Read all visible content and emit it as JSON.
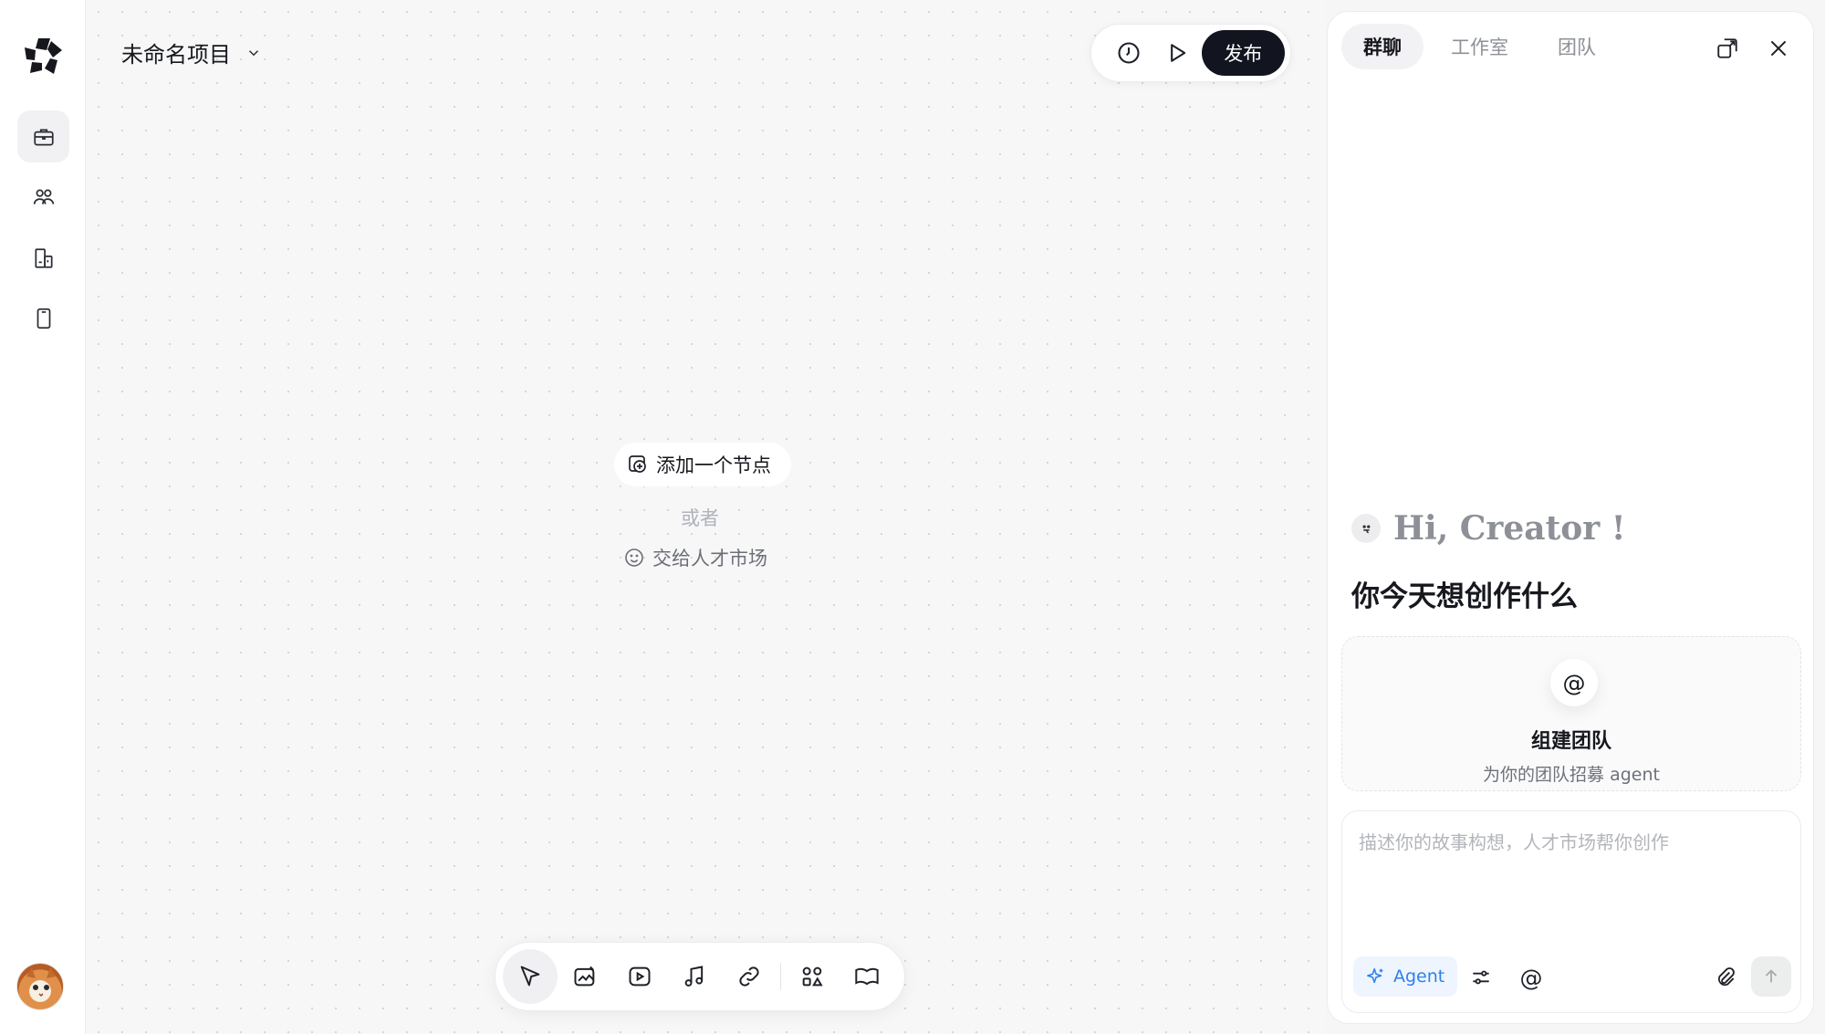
{
  "project": {
    "title": "未命名项目"
  },
  "topbar": {
    "publish_label": "发布"
  },
  "canvas": {
    "add_node_label": "添加一个节点",
    "or_label": "或者",
    "talent_label": "交给人才市场"
  },
  "panel": {
    "tabs": [
      {
        "label": "群聊"
      },
      {
        "label": "工作室"
      },
      {
        "label": "团队"
      }
    ],
    "greeting": "Hi, Creator !",
    "question": "你今天想创作什么",
    "team_card": {
      "icon_symbol": "@",
      "title": "组建团队",
      "subtitle": "为你的团队招募 agent"
    },
    "composer": {
      "placeholder": "描述你的故事构想，人才市场帮你创作",
      "agent_label": "Agent",
      "mention_symbol": "@"
    }
  },
  "icons": {
    "rail": [
      "briefcase-icon",
      "users-icon",
      "building-icon",
      "phone-icon"
    ],
    "bottom_toolbar": [
      "cursor-icon",
      "image-icon",
      "video-icon",
      "music-icon",
      "link-icon",
      "shapes-icon",
      "book-icon"
    ]
  },
  "colors": {
    "accent_dark": "#12151f",
    "agent_blue": "#2f80ed"
  }
}
